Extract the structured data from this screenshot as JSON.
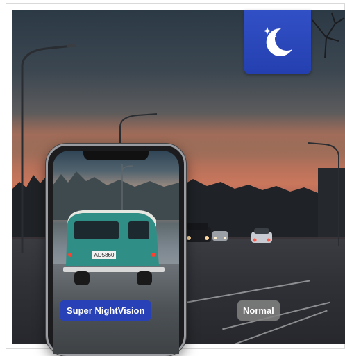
{
  "labels": {
    "super_nightvision": "Super NightVision",
    "normal": "Normal"
  },
  "icons": {
    "mode_badge": "moon-stars-icon"
  },
  "colors": {
    "badge_blue": "#2a45ba",
    "super_label_bg": "#2841b6",
    "normal_label_bg": "#828282"
  }
}
